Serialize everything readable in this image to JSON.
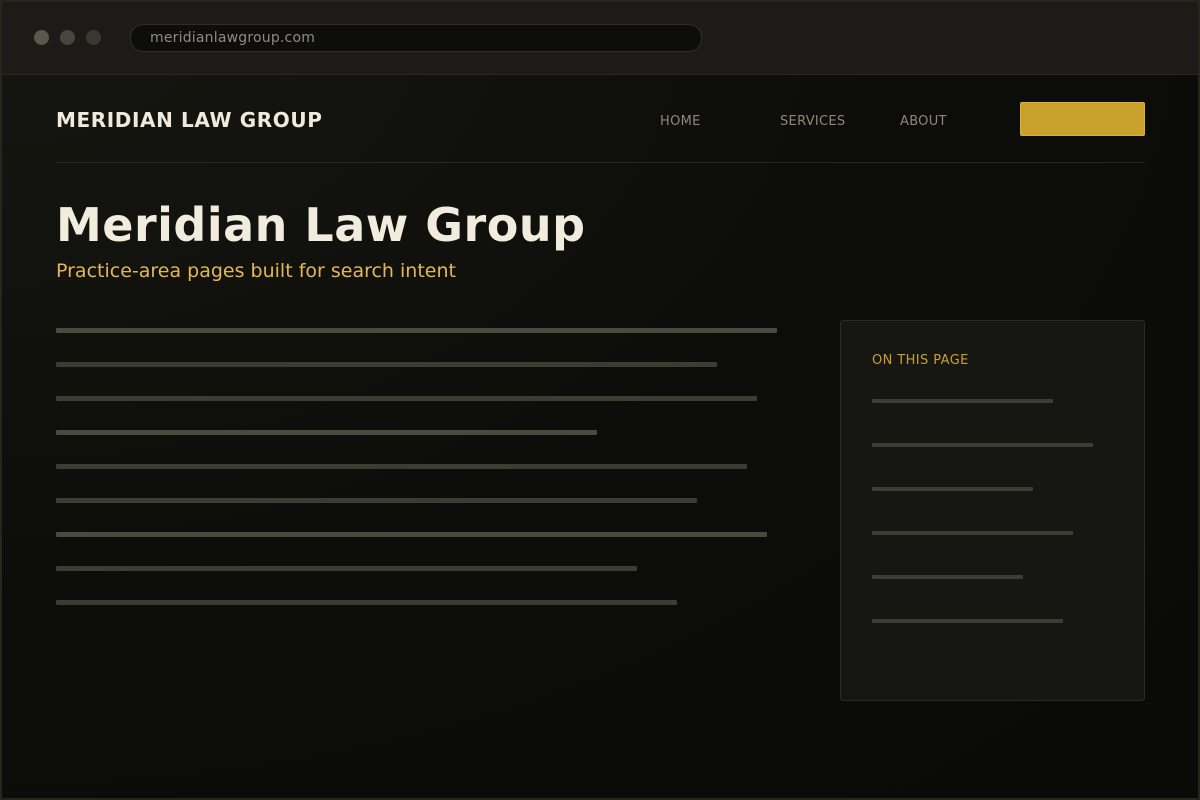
{
  "browser": {
    "url": "meridianlawgroup.com"
  },
  "nav": {
    "brand": "MERIDIAN LAW GROUP",
    "links": [
      "HOME",
      "SERVICES",
      "ABOUT"
    ],
    "cta_label": ""
  },
  "hero": {
    "title": "Meridian Law Group",
    "subtitle": "Practice-area pages built for search intent"
  },
  "toc": {
    "heading": "ON THIS PAGE"
  },
  "colors": {
    "accent_gold": "#c9a22e",
    "subtitle_gold": "#e2b75a",
    "background": "#0b0b09"
  }
}
